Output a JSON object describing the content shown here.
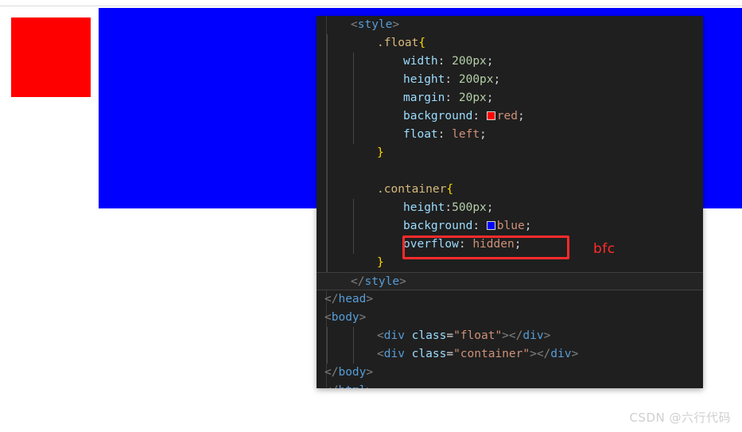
{
  "render_preview": {
    "float_box": {
      "name": "float",
      "color": "#ff0000"
    },
    "container_box": {
      "name": "container",
      "color": "#0000ff"
    }
  },
  "editor": {
    "lines": [
      {
        "indent": 0,
        "guides": 0,
        "active": false,
        "tokens": [
          {
            "c": "t-angle",
            "t": "<"
          },
          {
            "c": "t-tag",
            "t": "style"
          },
          {
            "c": "t-angle",
            "t": ">"
          }
        ]
      },
      {
        "indent": 1,
        "guides": 1,
        "active": false,
        "tokens": [
          {
            "c": "t-sel",
            "t": ".float"
          },
          {
            "c": "t-brace",
            "t": "{"
          }
        ]
      },
      {
        "indent": 2,
        "guides": 2,
        "active": false,
        "tokens": [
          {
            "c": "t-prop",
            "t": "width"
          },
          {
            "c": "t-punc",
            "t": ": "
          },
          {
            "c": "t-num",
            "t": "200px"
          },
          {
            "c": "t-punc",
            "t": ";"
          }
        ]
      },
      {
        "indent": 2,
        "guides": 2,
        "active": false,
        "tokens": [
          {
            "c": "t-prop",
            "t": "height"
          },
          {
            "c": "t-punc",
            "t": ": "
          },
          {
            "c": "t-num",
            "t": "200px"
          },
          {
            "c": "t-punc",
            "t": ";"
          }
        ]
      },
      {
        "indent": 2,
        "guides": 2,
        "active": false,
        "tokens": [
          {
            "c": "t-prop",
            "t": "margin"
          },
          {
            "c": "t-punc",
            "t": ": "
          },
          {
            "c": "t-num",
            "t": "20px"
          },
          {
            "c": "t-punc",
            "t": ";"
          }
        ]
      },
      {
        "indent": 2,
        "guides": 2,
        "active": false,
        "tokens": [
          {
            "c": "t-prop",
            "t": "background"
          },
          {
            "c": "t-punc",
            "t": ": "
          },
          {
            "swatch": "#ff0000"
          },
          {
            "c": "t-val",
            "t": "red"
          },
          {
            "c": "t-punc",
            "t": ";"
          }
        ]
      },
      {
        "indent": 2,
        "guides": 2,
        "active": false,
        "tokens": [
          {
            "c": "t-prop",
            "t": "float"
          },
          {
            "c": "t-punc",
            "t": ": "
          },
          {
            "c": "t-val",
            "t": "left"
          },
          {
            "c": "t-punc",
            "t": ";"
          }
        ]
      },
      {
        "indent": 1,
        "guides": 1,
        "active": false,
        "tokens": [
          {
            "c": "t-brace",
            "t": "}"
          }
        ]
      },
      {
        "indent": 0,
        "guides": 1,
        "active": false,
        "tokens": []
      },
      {
        "indent": 1,
        "guides": 1,
        "active": false,
        "tokens": [
          {
            "c": "t-sel",
            "t": ".container"
          },
          {
            "c": "t-brace",
            "t": "{"
          }
        ]
      },
      {
        "indent": 2,
        "guides": 2,
        "active": false,
        "tokens": [
          {
            "c": "t-prop",
            "t": "height"
          },
          {
            "c": "t-punc",
            "t": ":"
          },
          {
            "c": "t-num",
            "t": "500px"
          },
          {
            "c": "t-punc",
            "t": ";"
          }
        ]
      },
      {
        "indent": 2,
        "guides": 2,
        "active": false,
        "tokens": [
          {
            "c": "t-prop",
            "t": "background"
          },
          {
            "c": "t-punc",
            "t": ": "
          },
          {
            "swatch": "#0000ff"
          },
          {
            "c": "t-val",
            "t": "blue"
          },
          {
            "c": "t-punc",
            "t": ";"
          }
        ]
      },
      {
        "indent": 2,
        "guides": 2,
        "active": false,
        "tokens": [
          {
            "c": "t-prop",
            "t": "overflow"
          },
          {
            "c": "t-punc",
            "t": ": "
          },
          {
            "c": "t-val",
            "t": "hidden"
          },
          {
            "c": "t-punc",
            "t": ";"
          }
        ]
      },
      {
        "indent": 1,
        "guides": 1,
        "active": false,
        "tokens": [
          {
            "c": "t-brace",
            "t": "}"
          }
        ]
      },
      {
        "indent": 0,
        "guides": 0,
        "active": true,
        "tokens": [
          {
            "c": "t-angle",
            "t": "</"
          },
          {
            "c": "t-tag",
            "t": "style"
          },
          {
            "c": "t-angle",
            "t": ">"
          }
        ]
      },
      {
        "indent": -1,
        "guides": 0,
        "active": false,
        "tokens": [
          {
            "c": "t-angle",
            "t": "</"
          },
          {
            "c": "t-tag",
            "t": "head"
          },
          {
            "c": "t-angle",
            "t": ">"
          }
        ]
      },
      {
        "indent": -1,
        "guides": 0,
        "active": false,
        "tokens": [
          {
            "c": "t-angle",
            "t": "<"
          },
          {
            "c": "t-tag",
            "t": "body"
          },
          {
            "c": "t-angle",
            "t": ">"
          }
        ]
      },
      {
        "indent": 1,
        "guides": 2,
        "active": false,
        "tokens": [
          {
            "c": "t-angle",
            "t": "<"
          },
          {
            "c": "t-tag",
            "t": "div"
          },
          {
            "c": "t-punc",
            "t": " "
          },
          {
            "c": "t-attr",
            "t": "class"
          },
          {
            "c": "t-punc",
            "t": "="
          },
          {
            "c": "t-str",
            "t": "\"float\""
          },
          {
            "c": "t-angle",
            "t": "></"
          },
          {
            "c": "t-tag",
            "t": "div"
          },
          {
            "c": "t-angle",
            "t": ">"
          }
        ]
      },
      {
        "indent": 1,
        "guides": 2,
        "active": false,
        "tokens": [
          {
            "c": "t-angle",
            "t": "<"
          },
          {
            "c": "t-tag",
            "t": "div"
          },
          {
            "c": "t-punc",
            "t": " "
          },
          {
            "c": "t-attr",
            "t": "class"
          },
          {
            "c": "t-punc",
            "t": "="
          },
          {
            "c": "t-str",
            "t": "\"container\""
          },
          {
            "c": "t-angle",
            "t": "></"
          },
          {
            "c": "t-tag",
            "t": "div"
          },
          {
            "c": "t-angle",
            "t": ">"
          }
        ]
      },
      {
        "indent": -1,
        "guides": 0,
        "active": false,
        "tokens": [
          {
            "c": "t-angle",
            "t": "</"
          },
          {
            "c": "t-tag",
            "t": "body"
          },
          {
            "c": "t-angle",
            "t": ">"
          }
        ]
      },
      {
        "indent": -1,
        "guides": 0,
        "active": false,
        "tokens": [
          {
            "c": "t-angle",
            "t": "</"
          },
          {
            "c": "t-tag",
            "t": "html"
          },
          {
            "c": "t-angle",
            "t": ">"
          }
        ]
      }
    ]
  },
  "annotation": {
    "highlight_target": "overflow: hidden;",
    "label": "bfc",
    "color": "#ff2b2b"
  },
  "watermark": {
    "text": "CSDN @六行代码"
  }
}
